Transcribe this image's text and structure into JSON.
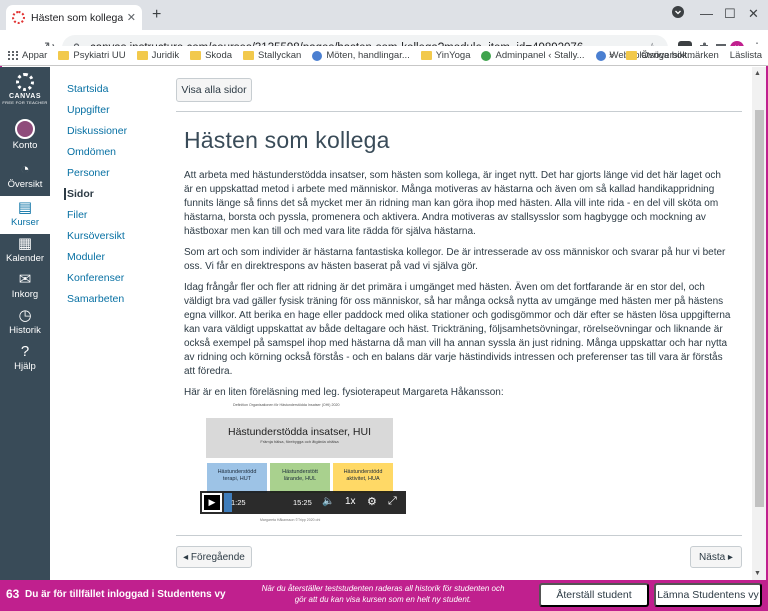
{
  "browser": {
    "tab_title": "Hästen som kollega: Stallyckan",
    "tab_close": "✕",
    "new_tab": "+",
    "url": "canvas.instructure.com/courses/3135598/pages/hasten-som-kollega?module_item_id=49892076",
    "back": "←",
    "forward": "→",
    "reload": "↻",
    "lock": "🔒",
    "star": "☆",
    "min": "—",
    "max": "☐",
    "close": "✕",
    "profile_initial": "u",
    "bookmarks": [
      "Appar",
      "Psykiatri UU",
      "Juridik",
      "Skoda",
      "Stallyckan",
      "Möten, handlingar...",
      "YinYoga",
      "Adminpanel ‹ Stally...",
      "Webbplatsöversikt..."
    ],
    "bookmarks_more": "»",
    "bookmarks_right": [
      "Övriga bokmärken",
      "Läslista"
    ]
  },
  "globalnav": {
    "logo_word": "CANVAS",
    "logo_sub": "FREE FOR TEACHER",
    "items": [
      {
        "label": "Konto",
        "icon": "avatar"
      },
      {
        "label": "Översikt",
        "icon": "dashboard-icon",
        "glyph": "◔"
      },
      {
        "label": "Kurser",
        "icon": "courses-icon",
        "glyph": "▤",
        "active": true
      },
      {
        "label": "Kalender",
        "icon": "calendar-icon",
        "glyph": "▦"
      },
      {
        "label": "Inkorg",
        "icon": "inbox-icon",
        "glyph": "✉"
      },
      {
        "label": "Historik",
        "icon": "history-icon",
        "glyph": "◷"
      },
      {
        "label": "Hjälp",
        "icon": "help-icon",
        "glyph": "?"
      }
    ]
  },
  "coursenav": {
    "items": [
      "Startsida",
      "Uppgifter",
      "Diskussioner",
      "Omdömen",
      "Personer",
      "Sidor",
      "Filer",
      "Kursöversikt",
      "Moduler",
      "Konferenser",
      "Samarbeten"
    ],
    "active": "Sidor"
  },
  "page": {
    "show_all_label": "Visa alla sidor",
    "title": "Hästen som kollega",
    "paragraphs": [
      "Att arbeta med hästunderstödda insatser, som hästen som kollega, är inget nytt. Det har gjorts länge vid det här laget och är en uppskattad metod i arbete med människor. Många motiveras av hästarna och även om så kallad handikappridning funnits länge så finns det så mycket mer än ridning man kan göra ihop med hästen. Alla vill inte rida - en del vill sköta om hästarna, borsta och pyssla, promenera och aktivera. Andra motiveras av stallsysslor som hagbygge och mockning av hästboxar men kan till och med vara lite rädda för själva hästarna.",
      "Som art och som individer är hästarna fantastiska kollegor. De är intresserade av oss människor och svarar på hur vi beter oss. Vi får en direktrespons av hästen baserat på vad vi själva gör.",
      "Idag frångår fler och fler att ridning är det primära i umgänget med hästen. Även om det fortfarande är en stor del, och väldigt bra vad gäller fysisk träning för oss människor, så har många också nytta av umgänge med hästen mer på hästens egna villkor. Att berika en hage eller paddock med olika stationer och godisgömmor och där efter se hästen lösa uppgifterna kan vara väldigt uppskattat av både deltagare och häst. Trickträning, följsamhetsövningar, rörelseövningar och liknande är också exempel på samspel ihop med hästarna då man vill ha annan syssla än just ridning. Många uppskattar och har nytta av ridning och körning också förstås - och en balans där varje hästindivids intressen och preferenser tas till vara är förstås att föredra.",
      "Här är en liten föreläsning med leg. fysioterapeut Margareta Håkansson:"
    ],
    "video": {
      "slide_caption": "Definition Organisationen för Hästunderstödda Insatser (OHI) 2020",
      "slide_title": "Hästunderstödda insatser, HUI",
      "slide_subtitle": "Främja hälsa, förebygga och åtgärda ohälsa",
      "boxes": [
        {
          "line1": "Hästunderstödd",
          "line2": "terapi, HUT",
          "color": "#9dc3e6"
        },
        {
          "line1": "Hästunderstött",
          "line2": "lärande, HUL",
          "color": "#a9d18e"
        },
        {
          "line1": "Hästunderstödd",
          "line2": "aktivitet, HUA",
          "color": "#ffd966"
        }
      ],
      "slide_footer": "Margareta Håkansson ©Tripp 2020 ohi",
      "current_time": "1:25",
      "duration": "15:25",
      "progress": 0.09,
      "speed": "1x",
      "play_glyph": "▶",
      "volume_glyph": "🔈",
      "settings_glyph": "⚙",
      "fullscreen_glyph": "⤢"
    },
    "prev_label": "◂ Föregående",
    "next_label": "Nästa ▸"
  },
  "studentview": {
    "icon": "63",
    "text": "Du är för tillfället inloggad i Studentens vy",
    "note": "När du återställer teststudenten raderas all historik för studenten och gör att du kan visa kursen som en helt ny student.",
    "reset_label": "Återställ student",
    "leave_label": "Lämna Studentens vy"
  },
  "colors": {
    "accent": "#c0208e",
    "nav_bg": "#394b58",
    "link": "#0770a3"
  }
}
